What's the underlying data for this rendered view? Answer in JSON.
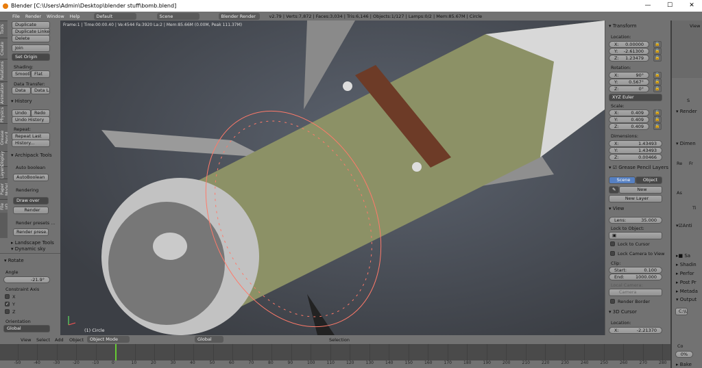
{
  "window": {
    "title": "Blender [C:\\Users\\Admin\\Desktop\\blender stuff\\bomb.blend]",
    "minimize": "—",
    "maximize": "☐",
    "close": "✕"
  },
  "topbar": {
    "menus": [
      "File",
      "Render",
      "Window",
      "Help"
    ],
    "screen": "Default",
    "scene": "Scene",
    "engine": "Blender Render",
    "stats": "v2.79 | Verts:7,872 | Faces:3,034 | Tris:6,146 | Objects:1/127 | Lamps:0/2 | Mem:85.67M | Circle"
  },
  "left_tabs": [
    "Tools",
    "Create",
    "Relations",
    "Animation",
    "Physics",
    "Grease Pencil",
    "Display",
    "Layers",
    "Paper Model",
    "File I/O"
  ],
  "tools": {
    "duplicate": "Duplicate",
    "duplicate_linked": "Duplicate Linked",
    "delete": "Delete",
    "join": "Join",
    "set_origin": "Set Origin",
    "shading": "Shading:",
    "smooth": "Smooth",
    "flat": "Flat",
    "data_transfer": "Data Transfer:",
    "data": "Data",
    "data_la": "Data La",
    "history": "History",
    "undo": "Undo",
    "redo": "Redo",
    "undo_history": "Undo History",
    "repeat": "Repeat:",
    "repeat_last": "Repeat Last",
    "history_btn": "History...",
    "archipack": "Archipack Tools",
    "auto_boolean_lbl": "Auto boolean",
    "auto_boolean": "AutoBoolean",
    "rendering": "Rendering",
    "draw_over": "Draw over",
    "render": "Render",
    "render_presets": "Render presets ...",
    "render_prese": "Render prese...",
    "landscape": "Landscape Tools",
    "dynamic_sky": "Dynamic sky"
  },
  "operator": {
    "title": "Rotate",
    "angle_label": "Angle",
    "angle": "-21.9°",
    "constraint": "Constraint Axis",
    "x": "X",
    "y": "Y",
    "z": "Z",
    "y_checked": true,
    "orientation_label": "Orientation",
    "orientation": "Global"
  },
  "viewport": {
    "info": "Frame:1 | Time:00:00.40 | Ve:4544 Fa:3920 La:2 | Mem:85.66M (0.00M, Peak 111.37M)",
    "object_label": "(1) Circle"
  },
  "transform": {
    "title": "Transform",
    "location": "Location:",
    "loc": [
      [
        "X:",
        "0.00000"
      ],
      [
        "Y:",
        "-2.61300"
      ],
      [
        "Z:",
        "1.23479"
      ]
    ],
    "rotation": "Rotation:",
    "rot": [
      [
        "X:",
        "90°"
      ],
      [
        "Y:",
        "0.567°"
      ],
      [
        "Z:",
        "0°"
      ]
    ],
    "rot_mode": "XYZ Euler",
    "scale": "Scale:",
    "scl": [
      [
        "X:",
        "0.409"
      ],
      [
        "Y:",
        "0.409"
      ],
      [
        "Z:",
        "0.409"
      ]
    ],
    "dimensions": "Dimensions:",
    "dim": [
      [
        "X:",
        "1.43493"
      ],
      [
        "Y:",
        "1.43493"
      ],
      [
        "Z:",
        "0.00466"
      ]
    ]
  },
  "grease": {
    "title": "Grease Pencil Layers",
    "scene": "Scene",
    "object": "Object",
    "new": "New",
    "new_layer": "New Layer"
  },
  "view": {
    "title": "View",
    "lens_k": "Lens:",
    "lens": "35.000",
    "lock_obj": "Lock to Object:",
    "lock_cursor": "Lock to Cursor",
    "lock_camera": "Lock Camera to View",
    "clip": "Clip:",
    "start_k": "Start:",
    "start": "0.100",
    "end_k": "End:",
    "end": "1000.000",
    "local_camera": "Local Camera:",
    "camera": "Camera",
    "render_border": "Render Border"
  },
  "cursor": {
    "title": "3D Cursor",
    "location": "Location:",
    "x_k": "X:",
    "x": "-2.21370"
  },
  "props": {
    "view": "View",
    "s": "S",
    "render": "Render",
    "dimen": "Dimen",
    "re": "Re",
    "fr": "Fr",
    "as": "As",
    "ti": "Ti",
    "anti": "Anti",
    "sa": "Sa",
    "shading": "Shadin",
    "perf": "Perfor",
    "post": "Post Pr",
    "meta": "Metada",
    "output": "Output",
    "path": "C:\\U",
    "co": "Co",
    "pct": "0%",
    "bake": "Bake"
  },
  "vpheader": {
    "items": [
      "View",
      "Select",
      "Add",
      "Object"
    ],
    "mode": "Object Mode",
    "orientation": "Global",
    "selection": "Selection"
  },
  "timeline": {
    "ticks": [
      -50,
      -40,
      -30,
      -20,
      -10,
      0,
      10,
      20,
      30,
      40,
      50,
      60,
      70,
      80,
      90,
      100,
      110,
      120,
      130,
      140,
      150,
      160,
      170,
      180,
      190,
      200,
      210,
      220,
      230,
      240,
      250,
      260,
      270,
      280
    ],
    "current_frame": 0
  }
}
